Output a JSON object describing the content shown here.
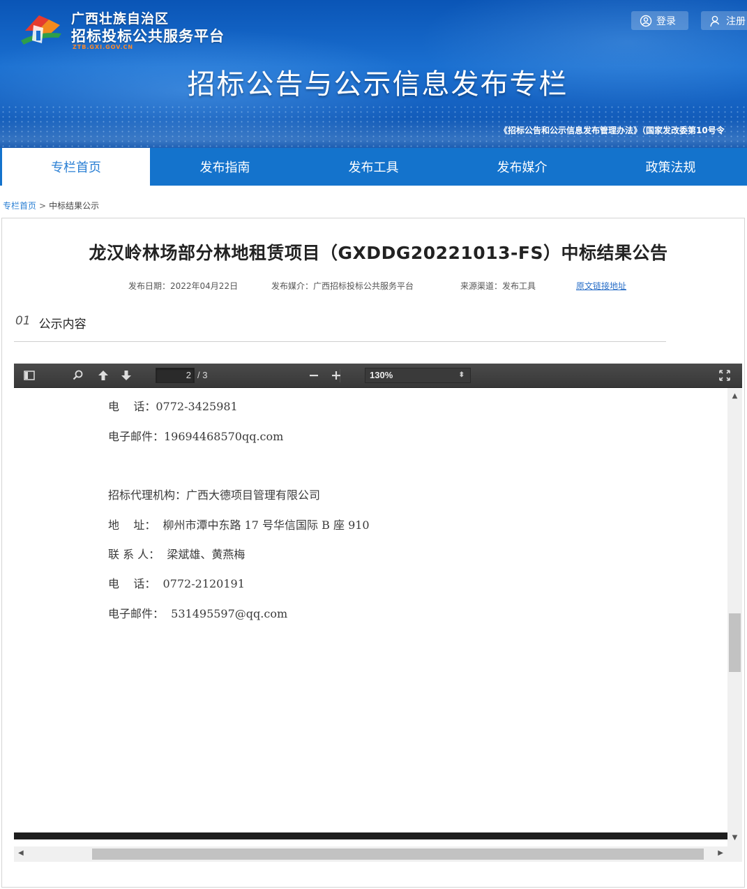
{
  "header": {
    "logo_line1": "广西壮族自治区",
    "logo_line2": "招标投标公共服务平台",
    "logo_url": "ZTB.GXI.GOV.CN",
    "banner_title": "招标公告与公示信息发布专栏",
    "banner_law": "《招标公告和公示信息发布管理办法》（国家发改委第10号令",
    "login_label": "登录",
    "register_label": "注册"
  },
  "nav": {
    "items": [
      {
        "label": "专栏首页",
        "active": true
      },
      {
        "label": "发布指南",
        "active": false
      },
      {
        "label": "发布工具",
        "active": false
      },
      {
        "label": "发布媒介",
        "active": false
      },
      {
        "label": "政策法规",
        "active": false
      }
    ]
  },
  "breadcrumb": {
    "home": "专栏首页",
    "separator": ">",
    "current": "中标结果公示"
  },
  "article": {
    "title": "龙汉岭林场部分林地租赁项目（GXDDG20221013-FS）中标结果公告",
    "meta_date": "发布日期：2022年04月22日",
    "meta_media": "发布媒介：广西招标投标公共服务平台",
    "meta_source": "来源渠道：发布工具",
    "meta_link": "原文链接地址",
    "section_number": "01",
    "section_title": "公示内容"
  },
  "pdf_viewer": {
    "current_page": "2",
    "page_count": "/ 3",
    "zoom": "130%",
    "vertical_scroll_fraction": 0.57,
    "horizontal_scroll_fraction": 0.12,
    "lines": [
      "电    话：0772-3425981",
      "电子邮件：19694468570qq.com",
      "招标代理机构：广西大德项目管理有限公司",
      "地    址：  柳州市潭中东路 17 号华信国际 B 座 910",
      "联 系 人：  梁斌雄、黄燕梅",
      "电    话：  0772-2120191",
      "电子邮件：  531495597@qq.com"
    ]
  }
}
